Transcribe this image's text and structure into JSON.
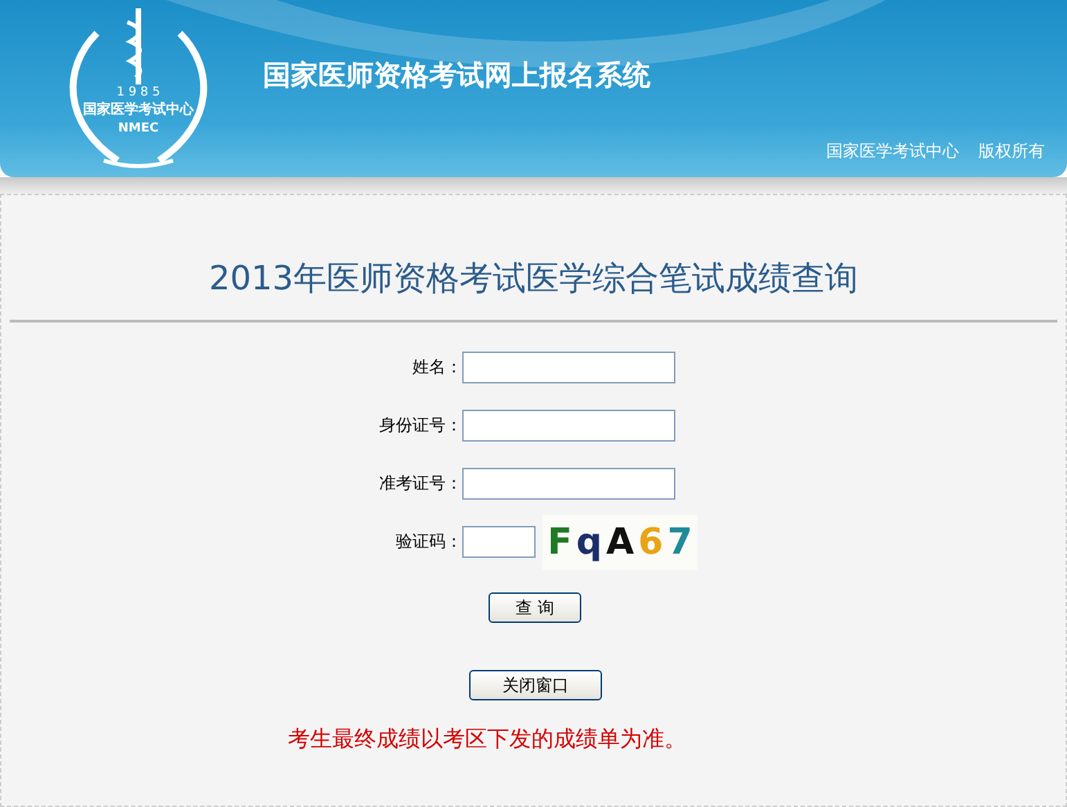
{
  "logo": {
    "year": "1 9 8 5",
    "name": "国家医学考试中心",
    "abbr": "NMEC"
  },
  "header": {
    "title": "国家医师资格考试网上报名系统",
    "links": [
      "国家医学考试中心",
      "版权所有"
    ]
  },
  "page_title": "2013年医师资格考试医学综合笔试成绩查询",
  "fields": [
    {
      "label": "姓名：",
      "kind": "text"
    },
    {
      "label": "身份证号：",
      "kind": "text"
    },
    {
      "label": "准考证号：",
      "kind": "text"
    },
    {
      "label": "验证码：",
      "kind": "captcha"
    }
  ],
  "captcha": [
    {
      "char": "F",
      "color": "#1f7a23"
    },
    {
      "char": "q",
      "color": "#1c2f6b"
    },
    {
      "char": "A",
      "color": "#111111"
    },
    {
      "char": "6",
      "color": "#e8a317"
    },
    {
      "char": "7",
      "color": "#1f8a9a"
    }
  ],
  "buttons": [
    "查 询",
    "关闭窗口"
  ],
  "notice": "考生最终成绩以考区下发的成绩单为准。"
}
